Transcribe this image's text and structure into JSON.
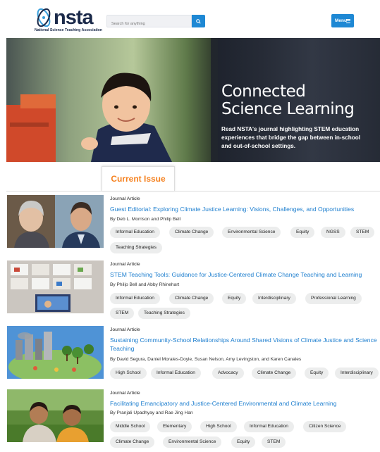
{
  "header": {
    "logo_text": "nsta",
    "logo_subtitle": "National Science Teaching Association",
    "search_placeholder": "Search for anything",
    "menu_label": "Menu"
  },
  "hero": {
    "title_line1": "Connected",
    "title_line2": "Science Learning",
    "subtitle": "Read NSTA's journal highlighting STEM education experiences that bridge the gap between in-school and out-of-school settings."
  },
  "section_tab": "Current Issue",
  "articles": [
    {
      "type": "Journal Article",
      "title": "Guest Editorial: Exploring Climate Justice Learning: Visions, Challenges, and Opportunities",
      "byline": "By Deb L. Morrison and Philip Bell",
      "tags": [
        "Informal Education",
        "Climate Change",
        "Environmental Science",
        "Equity",
        "NGSS",
        "STEM",
        "Teaching Strategies"
      ]
    },
    {
      "type": "Journal Article",
      "title": "STEM Teaching Tools: Guidance for Justice-Centered Climate Change Teaching and Learning",
      "byline": "By Philip Bell and Abby Rhinehart",
      "tags": [
        "Informal Education",
        "Climate Change",
        "Equity",
        "Interdisciplinary",
        "Professional Learning",
        "STEM",
        "Teaching Strategies"
      ]
    },
    {
      "type": "Journal Article",
      "title": "Sustaining Community-School Relationships Around Shared Visions of Climate Justice and Science Teaching",
      "byline": "By David Segura, Daniel Morales-Doyle, Susan Nelson, Amy Levingston, and Karen Canales",
      "tags": [
        "High School",
        "Informal Education",
        "Advocacy",
        "Climate Change",
        "Equity",
        "Interdisciplinary"
      ]
    },
    {
      "type": "Journal Article",
      "title": "Facilitating Emancipatory and Justice-Centered Environmental and Climate Learning",
      "byline": "By Pranjali Upadhyay and Rae Jing Han",
      "tags": [
        "Middle School",
        "Elementary",
        "High School",
        "Informal Education",
        "Citizen Science",
        "Climate Change",
        "Environmental Science",
        "Equity",
        "STEM"
      ]
    }
  ],
  "colors": {
    "brand_blue": "#1e88d4",
    "link_blue": "#1e7fcf",
    "accent_orange": "#f5811f",
    "navy": "#1b2a4a"
  }
}
